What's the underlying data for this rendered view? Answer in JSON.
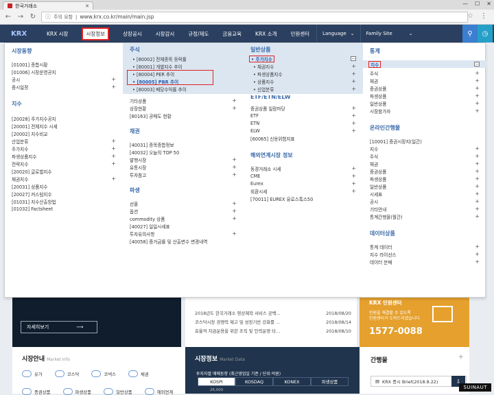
{
  "browser": {
    "tab_title": "한국거래소",
    "url_prefix": "주의 요함",
    "url": "www.krx.co.kr/main/main.jsp"
  },
  "gnb": {
    "logo": "KRX",
    "items": [
      "KRX 시장",
      "시장정보",
      "상장공시",
      "시장감시",
      "규정/제도",
      "금융교육",
      "KRX 소개",
      "민원센터"
    ],
    "language": "Language",
    "family": "Family Site"
  },
  "col1": {
    "title1": "시장동향",
    "items1": [
      {
        "label": "[01001] 종합시황",
        "plus": ""
      },
      {
        "label": "[01006] 시장운영공지",
        "plus": ""
      },
      {
        "label": "공시",
        "plus": "+"
      },
      {
        "label": "증시일정",
        "plus": "+"
      }
    ],
    "title2": "지수",
    "items2": [
      {
        "label": "[20028] 주가지수공지",
        "plus": ""
      },
      {
        "label": "[20001] 전체지수 시세",
        "plus": ""
      },
      {
        "label": "[20002] 지수비교",
        "plus": ""
      },
      {
        "label": "산업분류",
        "plus": "+"
      },
      {
        "label": "주가지수",
        "plus": "+"
      },
      {
        "label": "파생상품지수",
        "plus": "+"
      },
      {
        "label": "전략지수",
        "plus": "+"
      },
      {
        "label": "[20020] 글로벌지수",
        "plus": ""
      },
      {
        "label": "채권지수",
        "plus": "+"
      },
      {
        "label": "[20031] 상품지수",
        "plus": ""
      },
      {
        "label": "[20027] 커스텀지수",
        "plus": ""
      },
      {
        "label": "[01031] 지수산출방법",
        "plus": ""
      },
      {
        "label": "[01032] Factsheet",
        "plus": ""
      }
    ]
  },
  "col2": {
    "title1": "주식",
    "sub": [
      "[80002] 전체종목 등락률",
      "[80001] 개별지수 추이",
      "[80004] PER 추이",
      "[80005] PBR 추이",
      "[80003] 배당수익률 추이"
    ],
    "items1": [
      {
        "label": "기타상품",
        "plus": "+"
      },
      {
        "label": "상장현황",
        "plus": "+"
      },
      {
        "label": "[80163] 공매도 현황",
        "plus": ""
      }
    ],
    "title2": "채권",
    "items2": [
      {
        "label": "[40031] 종목종합정보",
        "plus": ""
      },
      {
        "label": "[40032] 오늘의 TOP 50",
        "plus": ""
      },
      {
        "label": "발행시장",
        "plus": "+"
      },
      {
        "label": "유통시장",
        "plus": "+"
      },
      {
        "label": "투자참고",
        "plus": "+"
      }
    ],
    "title3": "파생",
    "items3": [
      {
        "label": "선물",
        "plus": "+"
      },
      {
        "label": "옵션",
        "plus": "+"
      },
      {
        "label": "commodity 상품",
        "plus": "+"
      },
      {
        "label": "[40027] 일일시세표",
        "plus": ""
      },
      {
        "label": "투자유의사항",
        "plus": "+"
      },
      {
        "label": "[40058] 증거금률 및 산출변수 변경내역",
        "plus": ""
      }
    ]
  },
  "col3": {
    "title1": "일반상품",
    "sub": [
      {
        "label": "주가지수",
        "sign": "−"
      },
      {
        "label": "채권지수",
        "sign": "+"
      },
      {
        "label": "파생상품지수",
        "sign": "+"
      },
      {
        "label": "상품지수",
        "sign": "+"
      },
      {
        "label": "신업분류",
        "sign": "+"
      }
    ],
    "cut": "ETF/ETN/ELW",
    "items1": [
      {
        "label": "증권상품 일람마당",
        "plus": "+"
      },
      {
        "label": "ETF",
        "plus": "+"
      },
      {
        "label": "ETN",
        "plus": "+"
      },
      {
        "label": "ELW",
        "plus": "+"
      },
      {
        "label": "[60065] 신용위험지표",
        "plus": ""
      }
    ],
    "title2": "해외연계시장 정보",
    "items2": [
      {
        "label": "동경거래소 시세",
        "plus": "+"
      },
      {
        "label": "CME",
        "plus": "+"
      },
      {
        "label": "Eurex",
        "plus": "+"
      },
      {
        "label": "외환시세",
        "plus": "+"
      },
      {
        "label": "[70011] EUREX 유로스톡스50",
        "plus": ""
      }
    ]
  },
  "col4": {
    "title1": "통계",
    "sub_first": "지수",
    "items1": [
      {
        "label": "주식",
        "plus": "+"
      },
      {
        "label": "채권",
        "plus": "+"
      },
      {
        "label": "증권상품",
        "plus": "+"
      },
      {
        "label": "파생상품",
        "plus": "+"
      },
      {
        "label": "일반상품",
        "plus": "+"
      },
      {
        "label": "시장참가자",
        "plus": "+"
      }
    ],
    "title2": "온라인간행물",
    "items2": [
      {
        "label": "[10001] 증권시장지(일간)",
        "plus": ""
      },
      {
        "label": "지수",
        "plus": "+"
      },
      {
        "label": "주식",
        "plus": "+"
      },
      {
        "label": "채권",
        "plus": "+"
      },
      {
        "label": "증권상품",
        "plus": "+"
      },
      {
        "label": "파생상품",
        "plus": "+"
      },
      {
        "label": "일반상품",
        "plus": "+"
      },
      {
        "label": "시세표",
        "plus": "+"
      },
      {
        "label": "공시",
        "plus": "+"
      },
      {
        "label": "기타안내",
        "plus": "+"
      },
      {
        "label": "통계간행물(월간)",
        "plus": "+"
      }
    ],
    "title3": "데이터상품",
    "items3": [
      {
        "label": "통계 데이터",
        "plus": "+"
      },
      {
        "label": "지수 라이선스",
        "plus": "+"
      },
      {
        "label": "데이터 분배",
        "plus": "+"
      }
    ]
  },
  "bg": {
    "hero_btn": "자세히보기",
    "news": [
      {
        "title": "2018년도 한국거래소 영상제작 서비스 공백...",
        "date": "2018/08/20"
      },
      {
        "title": "코스닥시장 경쟁력 제고 및 성장기반 강화를 ...",
        "date": "2018/08/14"
      },
      {
        "title": "효율적 자금운용을 위한 조직 및 인력운영 타...",
        "date": "2018/08/10"
      }
    ],
    "center_title": "KRX 민원센터",
    "center_desc": "민원을 해결할 수 있도록\n민원센터가 도와드리겠습니다",
    "center_phone": "1577-0088",
    "market_info": "시장안내",
    "market_info_en": "Market Info",
    "market_icons": [
      "유가",
      "코스닥",
      "코넥스",
      "채권"
    ],
    "market_icons2": [
      "증권상품",
      "파생상품",
      "일반상품",
      "해외연계"
    ],
    "market_data": "시장정보",
    "market_data_en": "Market Data",
    "md_sub": "투자자별 매매동향 (최근영업일 기준 / 단위:억원)",
    "md_tabs": [
      "KOSPI",
      "KOSDAQ",
      "KONEX",
      "파생상품"
    ],
    "md_val": "26,000",
    "pub_title": "간행물",
    "pub_item": "KRX 증시 Brief(2018.8.22)",
    "watermark": "SUINAUT"
  }
}
